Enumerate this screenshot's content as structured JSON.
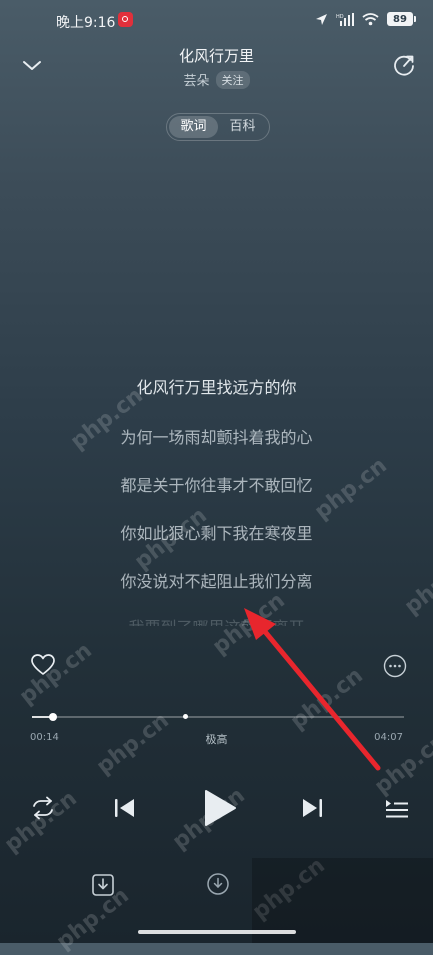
{
  "status_bar": {
    "time": "晚上9:16",
    "battery": "89",
    "icons": [
      "netease-app-icon",
      "location-icon",
      "hd-signal-icon",
      "wifi-icon",
      "battery-icon"
    ]
  },
  "header": {
    "song_title": "化风行万里",
    "artist": "芸朵",
    "follow_label": "关注",
    "tabs": [
      {
        "label": "歌词",
        "active": true
      },
      {
        "label": "百科",
        "active": false
      }
    ]
  },
  "lyrics": {
    "lines": [
      "化风行万里找远方的你",
      "为何一场雨却颤抖着我的心",
      "都是关于你往事才不敢回忆",
      "你如此狠心剩下我在寒夜里",
      "你没说对不起阻止我们分离",
      "我要到了哪里这就要离开"
    ],
    "current_index": 0
  },
  "player": {
    "current_time": "00:14",
    "total_time": "04:07",
    "progress": 0.057,
    "marker": 0.41,
    "quality_label": "极高"
  },
  "watermark": "php.cn",
  "colors": {
    "accent_arrow": "#e8262d",
    "battery_fill": "#f2f4f6"
  }
}
